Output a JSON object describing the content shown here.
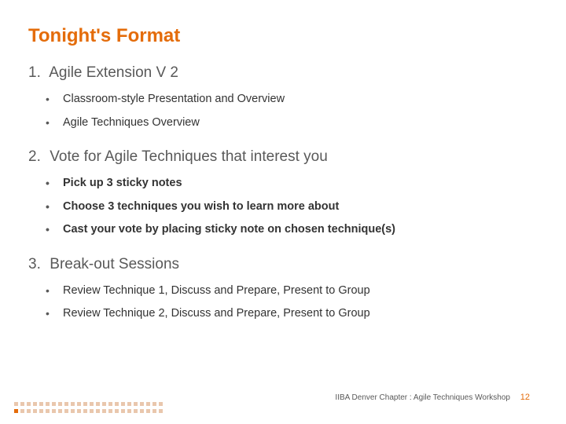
{
  "title": "Tonight's Format",
  "sections": [
    {
      "num": "1.",
      "heading": "Agile Extension V 2",
      "bullets": [
        "Classroom-style Presentation and Overview",
        "Agile Techniques Overview"
      ]
    },
    {
      "num": "2.",
      "heading": "Vote for Agile Techniques that interest you",
      "bullets": [
        "Pick up 3 sticky notes",
        "Choose 3 techniques you wish to learn more about",
        "Cast your vote by placing sticky note on chosen technique(s)"
      ]
    },
    {
      "num": "3.",
      "heading": "Break-out Sessions",
      "bullets": [
        "Review Technique 1, Discuss and Prepare, Present to Group",
        "Review Technique 2, Discuss and Prepare, Present to Group"
      ]
    }
  ],
  "footer": {
    "text": "IIBA Denver Chapter : Agile Techniques Workshop",
    "page": "12"
  }
}
